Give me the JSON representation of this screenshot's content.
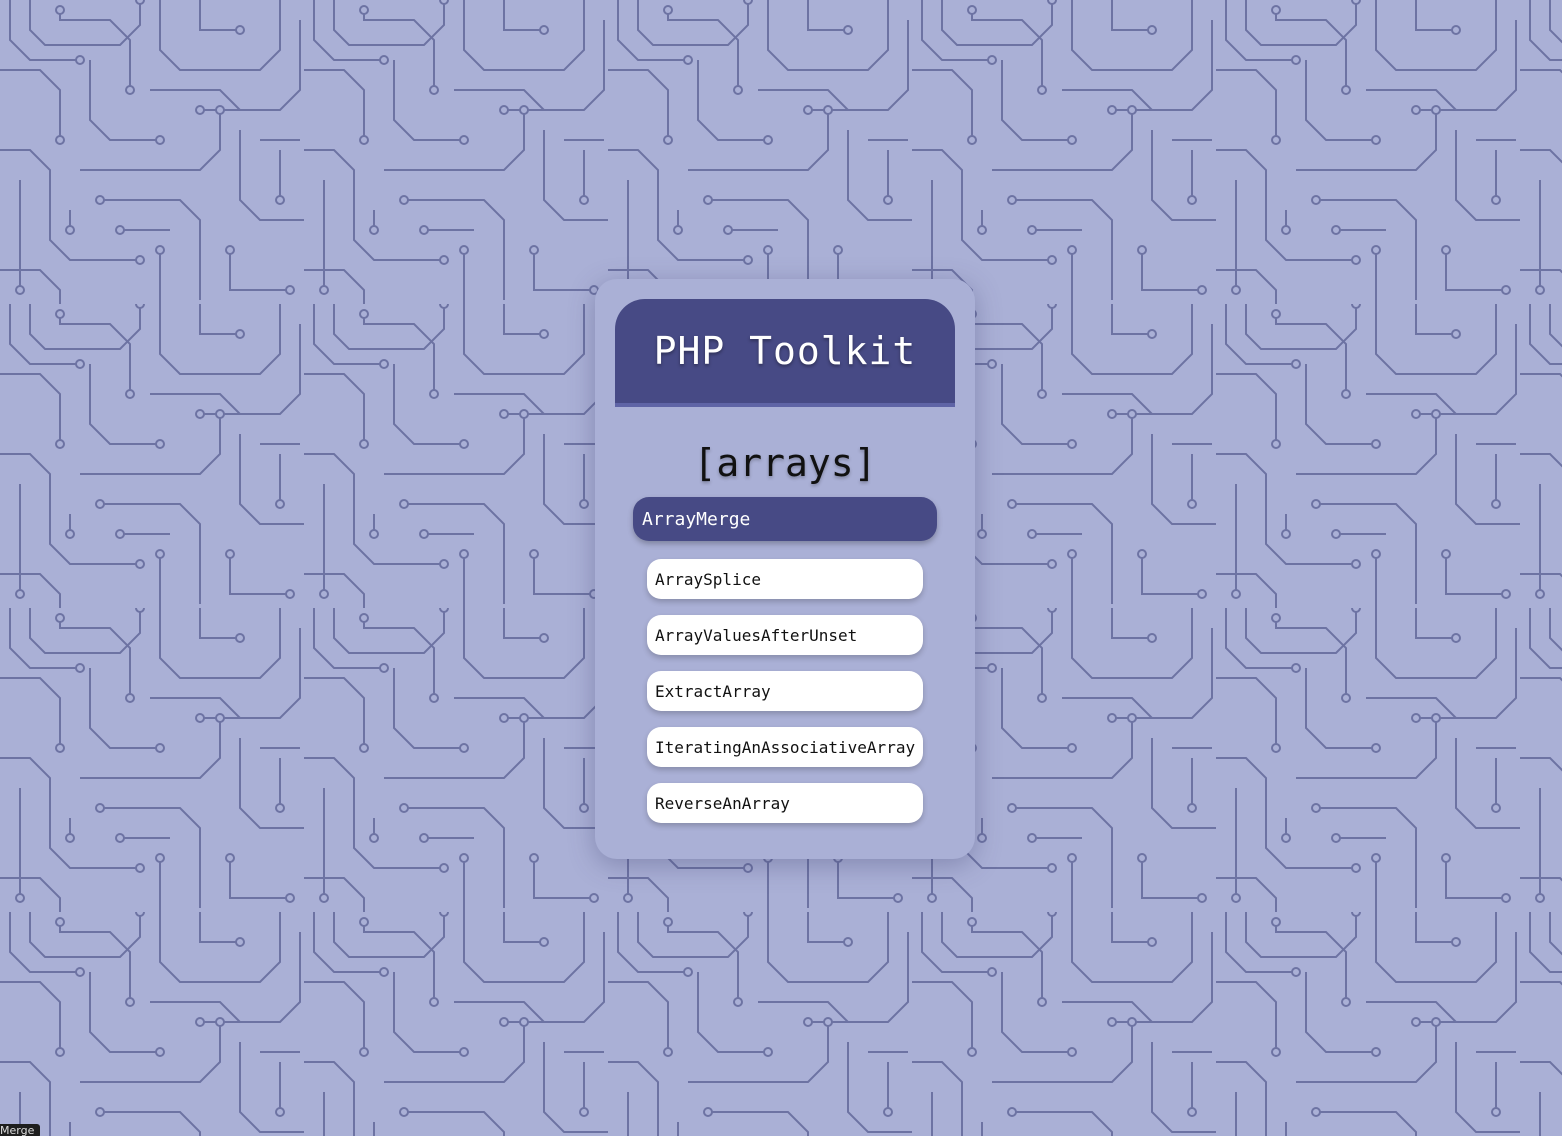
{
  "app": {
    "title": "PHP Toolkit"
  },
  "section": {
    "title": "[arrays]"
  },
  "selected_item": {
    "label": "ArrayMerge"
  },
  "items": [
    {
      "label": "ArraySplice"
    },
    {
      "label": "ArrayValuesAfterUnset"
    },
    {
      "label": "ExtractArray"
    },
    {
      "label": "IteratingAnAssociativeArray"
    },
    {
      "label": "ReverseAnArray"
    }
  ],
  "tooltip": {
    "text": "Merge"
  },
  "colors": {
    "background": "#aab0d6",
    "circuit_trace": "#6d73a3",
    "header": "#474a85",
    "item_background": "#ffffff"
  }
}
